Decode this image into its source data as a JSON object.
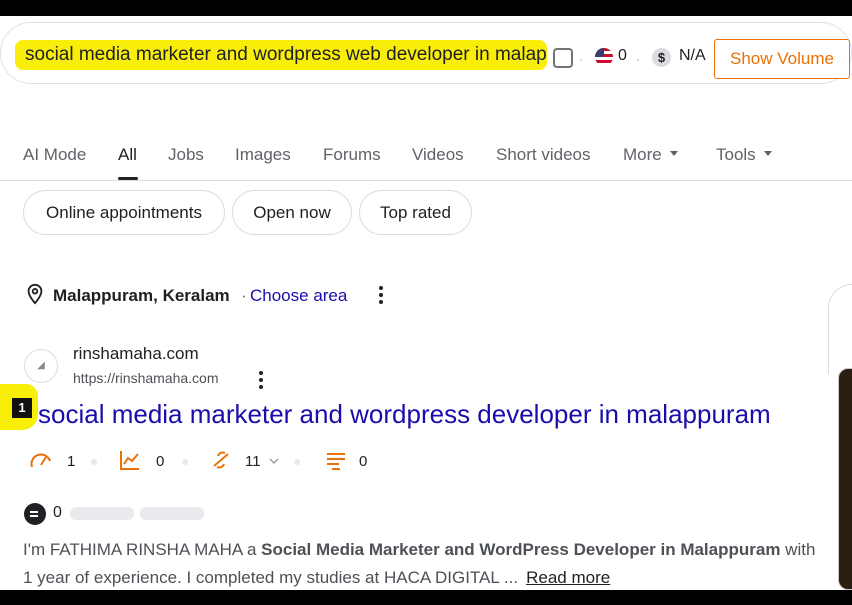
{
  "search": {
    "query": "social media marketer and wordpress web developer in malappuram",
    "volume_count": "0",
    "cpc": "N/A",
    "show_volume_label": "Show Volume",
    "separator": "·"
  },
  "tabs": [
    {
      "label": "AI Mode"
    },
    {
      "label": "All"
    },
    {
      "label": "Jobs"
    },
    {
      "label": "Images"
    },
    {
      "label": "Forums"
    },
    {
      "label": "Videos"
    },
    {
      "label": "Short videos"
    },
    {
      "label": "More"
    },
    {
      "label": "Tools"
    }
  ],
  "chips": [
    "Online appointments",
    "Open now",
    "Top rated"
  ],
  "location": {
    "name": "Malappuram, Keralam",
    "separator": "·",
    "choose_area": "Choose area"
  },
  "result": {
    "rank": "1",
    "site_name": "rinshamaha.com",
    "url": "https://rinshamaha.com",
    "title": "social media marketer and wordpress developer in malappuram",
    "metrics": {
      "speed": "1",
      "traffic": "0",
      "links": "11",
      "structure": "0"
    },
    "comments": "0",
    "snippet_start": "I'm FATHIMA RINSHA MAHA a ",
    "snippet_bold": "Social Media Marketer and WordPress Developer in Malappuram",
    "snippet_end": " with 1 year of experience. I completed my studies at HACA DIGITAL ...",
    "read_more": "Read more"
  },
  "colors": {
    "highlight": "#f9ee0a",
    "link": "#1a0dab",
    "accent": "#e8710a"
  }
}
